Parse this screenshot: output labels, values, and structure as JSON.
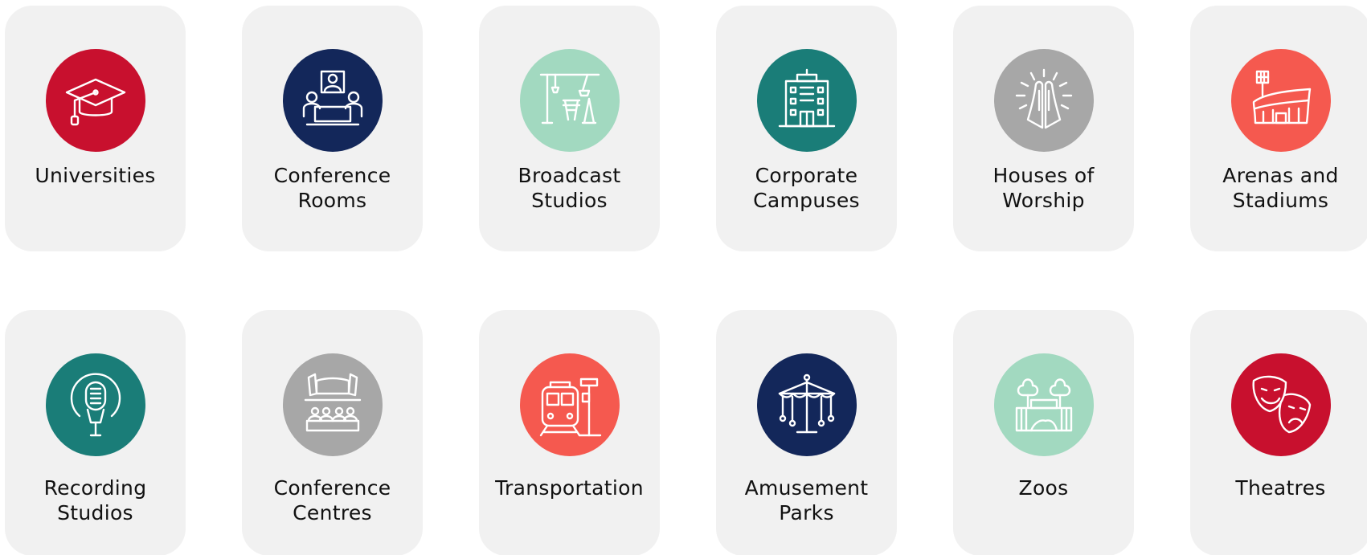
{
  "categories": [
    {
      "label": "Universities",
      "icon": "graduation-cap-icon",
      "color": "#c8102e"
    },
    {
      "label": "Conference\nRooms",
      "icon": "meeting-table-icon",
      "color": "#13275a"
    },
    {
      "label": "Broadcast\nStudios",
      "icon": "film-set-icon",
      "color": "#a2d9c0"
    },
    {
      "label": "Corporate\nCampuses",
      "icon": "office-building-icon",
      "color": "#1a7d78"
    },
    {
      "label": "Houses of\nWorship",
      "icon": "praying-hands-icon",
      "color": "#a7a7a7"
    },
    {
      "label": "Arenas and\nStadiums",
      "icon": "stadium-icon",
      "color": "#f5594f"
    },
    {
      "label": "Recording\nStudios",
      "icon": "microphone-icon",
      "color": "#1a7d78"
    },
    {
      "label": "Conference\nCentres",
      "icon": "auditorium-icon",
      "color": "#a7a7a7"
    },
    {
      "label": "Transportation",
      "icon": "train-icon",
      "color": "#f5594f"
    },
    {
      "label": "Amusement\nParks",
      "icon": "carousel-icon",
      "color": "#13275a"
    },
    {
      "label": "Zoos",
      "icon": "zoo-gate-icon",
      "color": "#a2d9c0"
    },
    {
      "label": "Theatres",
      "icon": "theatre-masks-icon",
      "color": "#c8102e"
    }
  ]
}
